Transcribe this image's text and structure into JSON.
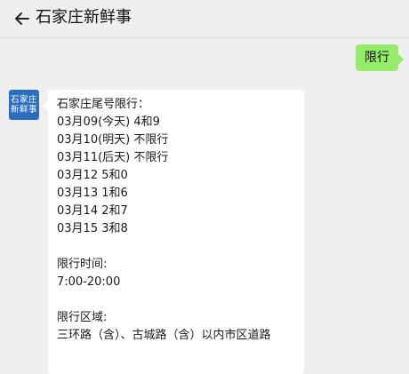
{
  "header": {
    "title": "石家庄新鲜事"
  },
  "outgoing": {
    "text": "限行"
  },
  "incoming": {
    "avatar_text_top": "石家庄",
    "avatar_text_bottom": "新鲜事",
    "lines": [
      "石家庄尾号限行：",
      "03月09(今天) 4和9",
      "03月10(明天) 不限行",
      "03月11(后天) 不限行",
      "03月12 5和0",
      "03月13 1和6",
      "03月14 2和7",
      "03月15 3和8",
      "限行时间:",
      "7:00-20:00",
      "限行区域:",
      "三环路（含）、古城路（含）以内市区道路"
    ]
  }
}
